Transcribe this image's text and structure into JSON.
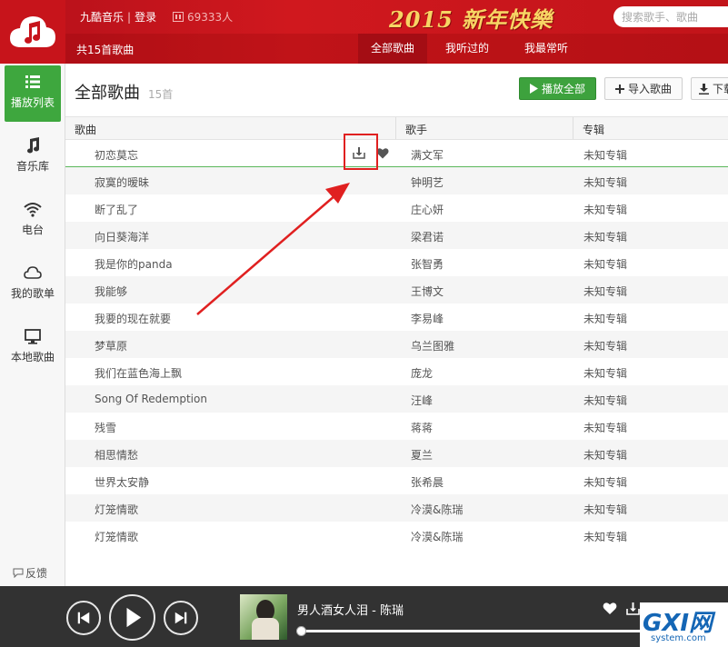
{
  "header": {
    "brand": "九酷音乐",
    "login": "登录",
    "separator": "|",
    "online_count": "69333人",
    "banner_text": "2015 新年快樂",
    "search_placeholder": "搜索歌手、歌曲",
    "song_count_label": "共15首歌曲",
    "tabs": [
      {
        "label": "全部歌曲",
        "active": true
      },
      {
        "label": "我听过的",
        "active": false
      },
      {
        "label": "我最常听",
        "active": false
      }
    ]
  },
  "sidebar": {
    "items": [
      {
        "label": "播放列表",
        "icon": "list-icon",
        "active": true
      },
      {
        "label": "音乐库",
        "icon": "music-note-icon",
        "active": false
      },
      {
        "label": "电台",
        "icon": "wifi-icon",
        "active": false
      },
      {
        "label": "我的歌单",
        "icon": "cloud-icon",
        "active": false
      },
      {
        "label": "本地歌曲",
        "icon": "monitor-icon",
        "active": false
      }
    ],
    "feedback": "反馈"
  },
  "main": {
    "title": "全部歌曲",
    "count": "15首",
    "play_all": "播放全部",
    "import": "导入歌曲",
    "download": "下载"
  },
  "table": {
    "columns": [
      "歌曲",
      "歌手",
      "专辑"
    ],
    "rows": [
      {
        "title": "初恋莫忘",
        "singer": "满文军",
        "album": "未知专辑"
      },
      {
        "title": "寂寞的暧昧",
        "singer": "钟明艺",
        "album": "未知专辑"
      },
      {
        "title": "断了乱了",
        "singer": "庄心妍",
        "album": "未知专辑"
      },
      {
        "title": "向日葵海洋",
        "singer": "梁君诺",
        "album": "未知专辑"
      },
      {
        "title": "我是你的panda",
        "singer": "张智勇",
        "album": "未知专辑"
      },
      {
        "title": "我能够",
        "singer": "王博文",
        "album": "未知专辑"
      },
      {
        "title": "我要的现在就要",
        "singer": "李易峰",
        "album": "未知专辑"
      },
      {
        "title": "梦草原",
        "singer": "乌兰图雅",
        "album": "未知专辑"
      },
      {
        "title": "我们在蓝色海上飘",
        "singer": "庞龙",
        "album": "未知专辑"
      },
      {
        "title": "Song Of Redemption",
        "singer": "汪峰",
        "album": "未知专辑"
      },
      {
        "title": "残雪",
        "singer": "蒋蒋",
        "album": "未知专辑"
      },
      {
        "title": "相思情愁",
        "singer": "夏兰",
        "album": "未知专辑"
      },
      {
        "title": "世界太安静",
        "singer": "张希晨",
        "album": "未知专辑"
      },
      {
        "title": "灯笼情歌",
        "singer": "冷漠&陈瑞",
        "album": "未知专辑"
      },
      {
        "title": "灯笼情歌",
        "singer": "冷漠&陈瑞",
        "album": "未知专辑"
      }
    ]
  },
  "player": {
    "now_playing": "男人酒女人泪 - 陈瑞",
    "progress": 0
  },
  "watermark": {
    "main": "GXI网",
    "sub": "system.com"
  },
  "colors": {
    "header_red": "#c7141b",
    "accent_green": "#3da23d",
    "annotation_red": "#e02020",
    "player_bg": "#323232"
  }
}
